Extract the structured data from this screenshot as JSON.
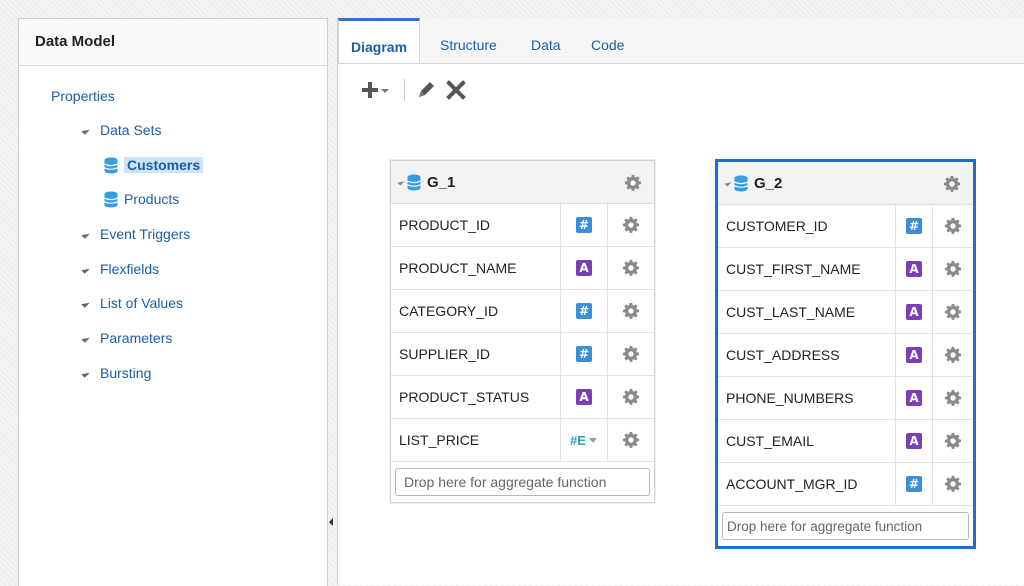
{
  "left": {
    "title": "Data Model",
    "tree": {
      "properties": "Properties",
      "data_sets": "Data Sets",
      "customers": "Customers",
      "products": "Products",
      "event_triggers": "Event Triggers",
      "flexfields": "Flexfields",
      "list_of_values": "List of Values",
      "parameters": "Parameters",
      "bursting": "Bursting"
    }
  },
  "tabs": [
    "Diagram",
    "Structure",
    "Data",
    "Code"
  ],
  "active_tab": "Diagram",
  "toolbar": {
    "add_icon": "plus-dropdown-icon",
    "edit_icon": "pencil-icon",
    "delete_icon": "close-icon"
  },
  "groups": [
    {
      "title": "G_1",
      "rows": [
        {
          "name": "PRODUCT_ID",
          "type": "number"
        },
        {
          "name": "PRODUCT_NAME",
          "type": "string"
        },
        {
          "name": "CATEGORY_ID",
          "type": "number"
        },
        {
          "name": "SUPPLIER_ID",
          "type": "number"
        },
        {
          "name": "PRODUCT_STATUS",
          "type": "string"
        },
        {
          "name": "LIST_PRICE",
          "type": "number-expression"
        }
      ],
      "drop_text": "Drop here for aggregate function"
    },
    {
      "title": "G_2",
      "rows": [
        {
          "name": "CUSTOMER_ID",
          "type": "number"
        },
        {
          "name": "CUST_FIRST_NAME",
          "type": "string"
        },
        {
          "name": "CUST_LAST_NAME",
          "type": "string"
        },
        {
          "name": "CUST_ADDRESS",
          "type": "string"
        },
        {
          "name": "PHONE_NUMBERS",
          "type": "string"
        },
        {
          "name": "CUST_EMAIL",
          "type": "string"
        },
        {
          "name": "ACCOUNT_MGR_ID",
          "type": "number"
        }
      ],
      "drop_text": "Drop here for aggregate function"
    }
  ],
  "badges": {
    "number": "#",
    "string": "A",
    "number_expression": "#E"
  },
  "colors": {
    "accent": "#1f6fc9",
    "link": "#1a5fa6",
    "number_badge": "#3a8fd6",
    "string_badge": "#7b3fb5",
    "selection": "#cfe3f7"
  }
}
